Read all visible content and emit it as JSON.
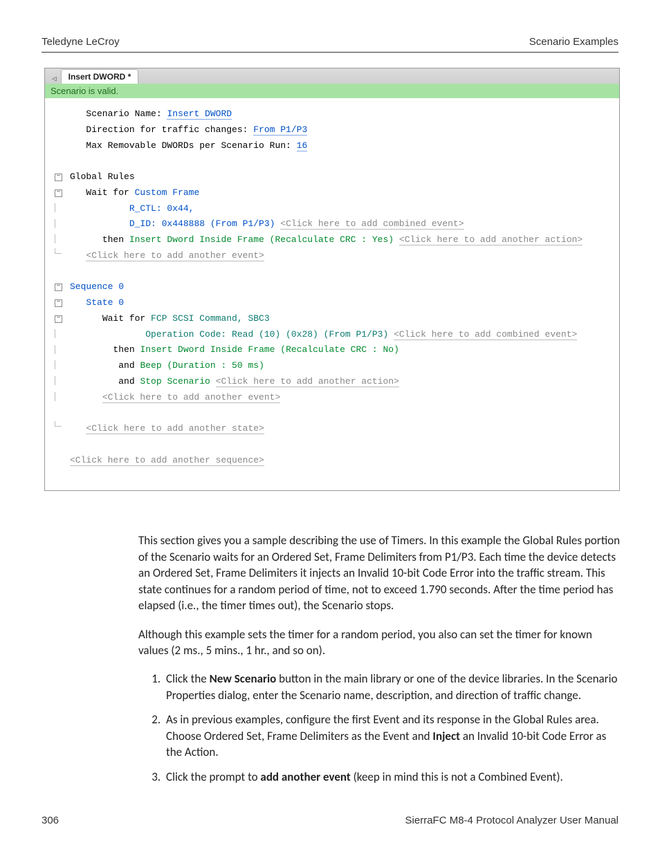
{
  "header": {
    "left": "Teledyne LeCroy",
    "right": "Scenario Examples"
  },
  "footer": {
    "left": "306",
    "right": "SierraFC M8-4 Protocol Analyzer User Manual"
  },
  "screenshot": {
    "tab_label": "Insert DWORD *",
    "valid_msg": "Scenario is valid.",
    "scenario_name_label": "Scenario Name: ",
    "scenario_name_value": "Insert DWORD",
    "direction_label": "Direction for traffic changes: ",
    "direction_value": "From P1/P3",
    "max_dwords_label": "Max Removable DWORDs per Scenario Run: ",
    "max_dwords_value": "16",
    "global_rules_label": "Global Rules",
    "gr_wait_for": "Wait for ",
    "gr_wait_target": "Custom Frame",
    "gr_rctl": "R_CTL: 0x44,",
    "gr_did_prefix": "D_ID: 0x448888 (From P1/P3) ",
    "gr_combined_event": "<Click here to add combined event>",
    "gr_then": "then ",
    "gr_action": "Insert Dword Inside Frame (Recalculate CRC : Yes) ",
    "gr_another_action": "<Click here to add another action>",
    "gr_another_event": "<Click here to add another event>",
    "seq0_label": "Sequence 0",
    "state0_label": "State 0",
    "s0_wait_for": "Wait for ",
    "s0_wait_target": "FCP SCSI Command, SBC3",
    "s0_opcode_prefix": "Operation Code: Read (10) (0x28) (From P1/P3) ",
    "s0_combined_event": "<Click here to add combined event>",
    "s0_then": "then ",
    "s0_action1": "Insert Dword Inside Frame (Recalculate CRC : No)",
    "s0_and1": "and ",
    "s0_action2": "Beep (Duration : 50 ms)",
    "s0_and2": "and ",
    "s0_action3": "Stop Scenario ",
    "s0_another_action": "<Click here to add another action>",
    "s0_another_event": "<Click here to add another event>",
    "another_state": "<Click here to add another state>",
    "another_sequence": "<Click here to add another sequence>"
  },
  "body": {
    "p1": "This section gives you a sample describing the use of Timers. In this example the Global Rules portion of the Scenario waits for an Ordered Set, Frame Delimiters from P1/P3. Each time the device detects an Ordered Set, Frame Delimiters it injects an Invalid 10-bit Code Error into the traffic stream. This state continues for a random period of time, not to exceed 1.790 seconds. After the time period has elapsed (i.e., the timer times out), the Scenario stops.",
    "p2": "Although this example sets the timer for a random period, you also can set the timer for known values (2 ms., 5 mins., 1 hr., and so on).",
    "li1_a": "Click the ",
    "li1_b": "New Scenario",
    "li1_c": " button in the main library or one of the device libraries. In the Scenario Properties dialog, enter the Scenario name, description, and direction of traffic change.",
    "li2_a": "As in previous examples, configure the first Event and its response in the Global Rules area. Choose Ordered Set, Frame Delimiters as the Event and ",
    "li2_b": "Inject",
    "li2_c": " an Invalid 10-bit Code Error as the Action.",
    "li3_a": "Click the prompt to ",
    "li3_b": "add another event",
    "li3_c": " (keep in mind this is not a Combined Event)."
  }
}
